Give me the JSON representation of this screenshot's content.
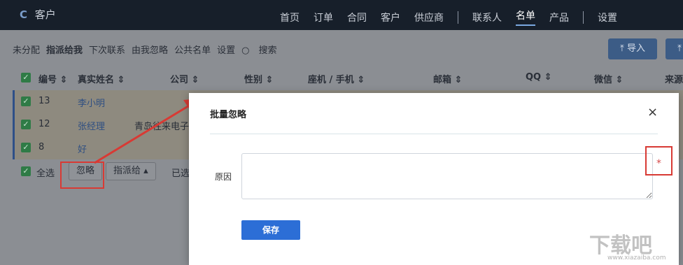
{
  "app": {
    "logo": "C",
    "title": "客户"
  },
  "nav": {
    "items": [
      "首页",
      "订单",
      "合同",
      "客户",
      "供应商"
    ],
    "items2": [
      "联系人",
      "名单",
      "产品"
    ],
    "items3": [
      "设置"
    ],
    "active": "名单"
  },
  "subnav": {
    "items": [
      "未分配",
      "指派给我",
      "下次联系",
      "由我忽略",
      "公共名单",
      "设置"
    ],
    "search": "搜索",
    "active": "指派给我"
  },
  "actions": {
    "import": "导入"
  },
  "table": {
    "headers": {
      "id": "编号",
      "name": "真实姓名",
      "company": "公司",
      "gender": "性别",
      "phone": "座机 / 手机",
      "email": "邮箱",
      "qq": "QQ",
      "wechat": "微信",
      "source": "来源"
    },
    "rows": [
      {
        "id": "13",
        "name": "李小明",
        "company": ""
      },
      {
        "id": "12",
        "name": "张经理",
        "company": "青岛往来电子"
      },
      {
        "id": "8",
        "name": "好",
        "company": ""
      }
    ],
    "footer": {
      "select_all": "全选",
      "ignore": "忽略",
      "assign": "指派给",
      "selected": "已选"
    }
  },
  "modal": {
    "title": "批量忽略",
    "close": "×",
    "reason_label": "原因",
    "reason_value": "",
    "required_mark": "*",
    "save": "保存"
  },
  "watermark": {
    "text": "下载吧",
    "url": "www.xiazaiba.com"
  },
  "colors": {
    "annotation": "#d83a34",
    "primary": "#2c6ed6"
  }
}
